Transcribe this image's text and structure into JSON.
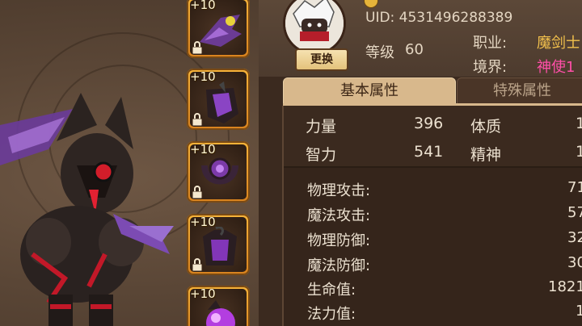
{
  "equipment": {
    "slots": [
      {
        "level": "+10",
        "icon": "dragon-wing-item"
      },
      {
        "level": "+10",
        "icon": "gauntlet-item"
      },
      {
        "level": "+10",
        "icon": "amulet-item"
      },
      {
        "level": "+10",
        "icon": "armor-item"
      },
      {
        "level": "+10",
        "icon": "orb-item"
      }
    ],
    "lock_icon": "lock-icon"
  },
  "profile": {
    "uid": "UID: 4531496288389",
    "level_label": "等级",
    "level_value": "60",
    "job_label": "职业:",
    "job_value": "魔剑士",
    "realm_label": "境界:",
    "realm_value": "神使1",
    "change_button": "更换"
  },
  "tabs": {
    "basic": "基本属性",
    "special": "特殊属性"
  },
  "primary_attributes": [
    {
      "label": "力量",
      "value": "396"
    },
    {
      "label": "体质",
      "value": "1"
    },
    {
      "label": "智力",
      "value": "541"
    },
    {
      "label": "精神",
      "value": "1"
    }
  ],
  "secondary_attributes": [
    {
      "label": "物理攻击:",
      "value": "71"
    },
    {
      "label": "魔法攻击:",
      "value": "57"
    },
    {
      "label": "物理防御:",
      "value": "32"
    },
    {
      "label": "魔法防御:",
      "value": "30"
    },
    {
      "label": "生命值:",
      "value": "1821"
    },
    {
      "label": "法力值:",
      "value": "1"
    }
  ],
  "colors": {
    "job": "#f2c04c",
    "realm": "#ff4fa8",
    "slot_border": "#f7b43a"
  }
}
